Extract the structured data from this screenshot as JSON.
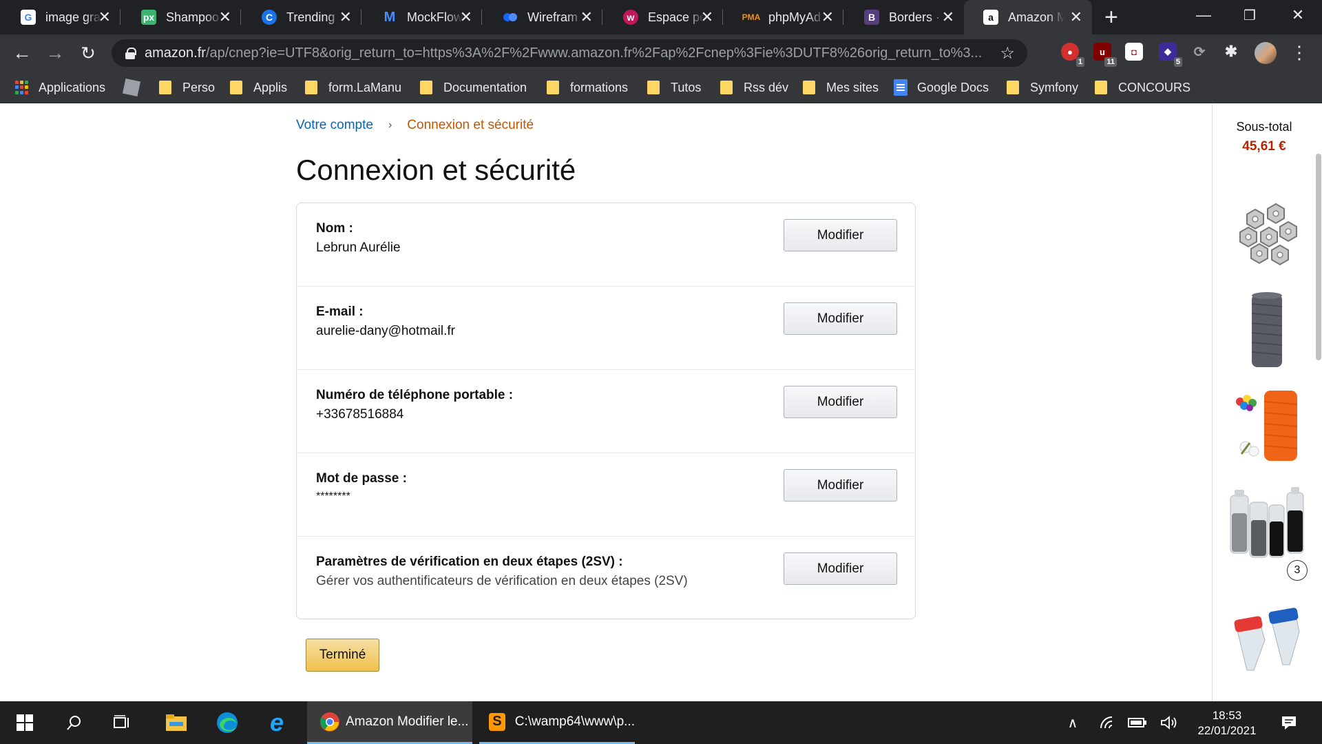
{
  "browser": {
    "tabs": [
      {
        "title": "image gra",
        "icon": "google-icon",
        "color": "#ffffff"
      },
      {
        "title": "Shampoo",
        "icon": "pixabay-icon",
        "color": "#3cb371"
      },
      {
        "title": "Trending",
        "icon": "trending-icon",
        "color": "#1a73e8"
      },
      {
        "title": "MockFlow",
        "icon": "mockflow-icon",
        "color": "#1c63d7"
      },
      {
        "title": "Wirefram",
        "icon": "wireframe-icon",
        "color": "#1565ff"
      },
      {
        "title": "Espace pe",
        "icon": "espace-icon",
        "color": "#c2185b"
      },
      {
        "title": "phpMyAd",
        "icon": "phpmyadmin-icon",
        "color": "#f29111"
      },
      {
        "title": "Borders ·",
        "icon": "bootstrap-icon",
        "color": "#563d7c"
      },
      {
        "title": "Amazon M",
        "icon": "amazon-icon",
        "color": "#ffffff"
      }
    ],
    "url_domain": "amazon.fr",
    "url_path": "/ap/cnep?ie=UTF8&orig_return_to=https%3A%2F%2Fwww.amazon.fr%2Fap%2Fcnep%3Fie%3DUTF8%26orig_return_to%3...",
    "extension_badges": [
      "1",
      "11",
      "5"
    ]
  },
  "bookmarks": [
    {
      "label": "Applications",
      "type": "apps"
    },
    {
      "label": "",
      "type": "roblox"
    },
    {
      "label": "Perso",
      "type": "folder"
    },
    {
      "label": "Applis",
      "type": "folder"
    },
    {
      "label": "form.LaManu",
      "type": "folder"
    },
    {
      "label": "Documentation",
      "type": "folder"
    },
    {
      "label": "formations",
      "type": "folder"
    },
    {
      "label": "Tutos",
      "type": "folder"
    },
    {
      "label": "Rss dév",
      "type": "folder"
    },
    {
      "label": "Mes sites",
      "type": "folder"
    },
    {
      "label": "Google Docs",
      "type": "gdocs"
    },
    {
      "label": "Symfony",
      "type": "folder"
    },
    {
      "label": "CONCOURS",
      "type": "folder"
    }
  ],
  "page": {
    "breadcrumb": {
      "account": "Votre compte",
      "separator": "›",
      "current": "Connexion et sécurité"
    },
    "title": "Connexion et sécurité",
    "rows": [
      {
        "label": "Nom :",
        "value": "Lebrun Aurélie",
        "button": "Modifier"
      },
      {
        "label": "E-mail :",
        "value": "aurelie-dany@hotmail.fr",
        "button": "Modifier"
      },
      {
        "label": "Numéro de téléphone portable :",
        "value": "+33678516884",
        "button": "Modifier"
      },
      {
        "label": "Mot de passe :",
        "value": "********",
        "button": "Modifier"
      },
      {
        "label": "Paramètres de vérification en deux étapes (2SV) :",
        "value": "Gérer vos authentificateurs de vérification en deux étapes (2SV)",
        "button": "Modifier"
      }
    ],
    "done_button": "Terminé"
  },
  "cart": {
    "subtotal_label": "Sous-total",
    "subtotal_value": "45,61 €",
    "quantity_badge": "3",
    "products": [
      "hex-nuts",
      "grey-cord-spool",
      "orange-cord-spool",
      "glass-bottles",
      "plastic-caps"
    ]
  },
  "taskbar": {
    "apps": [
      {
        "label": "Amazon Modifier le...",
        "icon": "chrome-icon"
      },
      {
        "label": "C:\\wamp64\\www\\p...",
        "icon": "sublime-icon"
      }
    ],
    "time": "18:53",
    "date": "22/01/2021"
  }
}
